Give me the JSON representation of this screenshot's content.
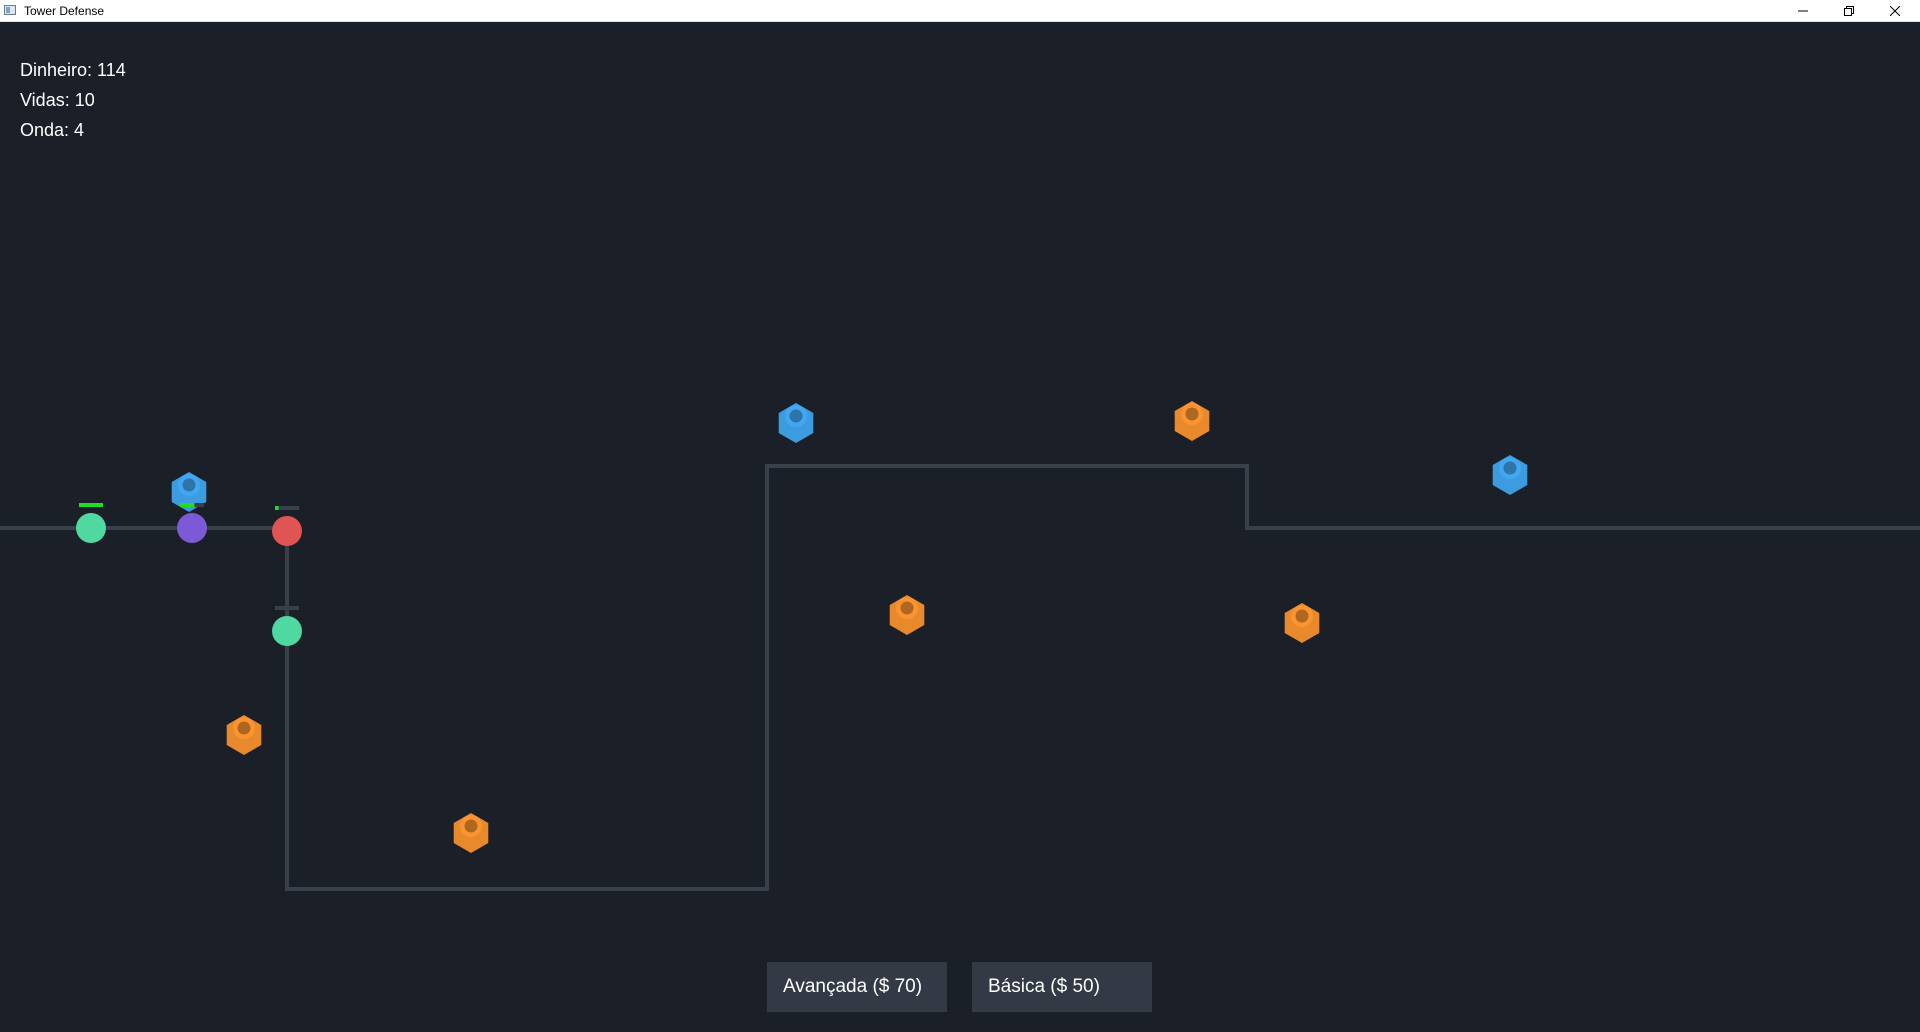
{
  "window": {
    "title": "Tower Defense",
    "controls": [
      "minimize-icon",
      "restore-icon",
      "close-icon"
    ]
  },
  "hud": {
    "money": "Dinheiro: 114",
    "lives": "Vidas: 10",
    "wave": "Onda: 4"
  },
  "shop": {
    "advanced_label": "Avançada ($ 70)",
    "basic_label": "Básica ($ 50)"
  },
  "towers": [
    {
      "type": "advanced",
      "color": "#3d9be0"
    },
    {
      "type": "advanced",
      "color": "#3d9be0"
    },
    {
      "type": "advanced",
      "color": "#3d9be0"
    },
    {
      "type": "basic",
      "color": "#e8892c"
    },
    {
      "type": "basic",
      "color": "#e8892c"
    },
    {
      "type": "basic",
      "color": "#e8892c"
    },
    {
      "type": "basic",
      "color": "#e8892c"
    },
    {
      "type": "basic",
      "color": "#e8892c"
    }
  ],
  "enemies": [
    {
      "color": "#4fd8a0",
      "health": 1.0
    },
    {
      "color": "#7c5ad6",
      "health": 0.6
    },
    {
      "color": "#e05454",
      "health": 0.15
    },
    {
      "color": "#4fd8a0",
      "health": 0.0
    }
  ],
  "colors": {
    "background": "#1b1f27",
    "path": "#3a404b",
    "button": "#333a46",
    "health_bar": "#22dd22"
  }
}
